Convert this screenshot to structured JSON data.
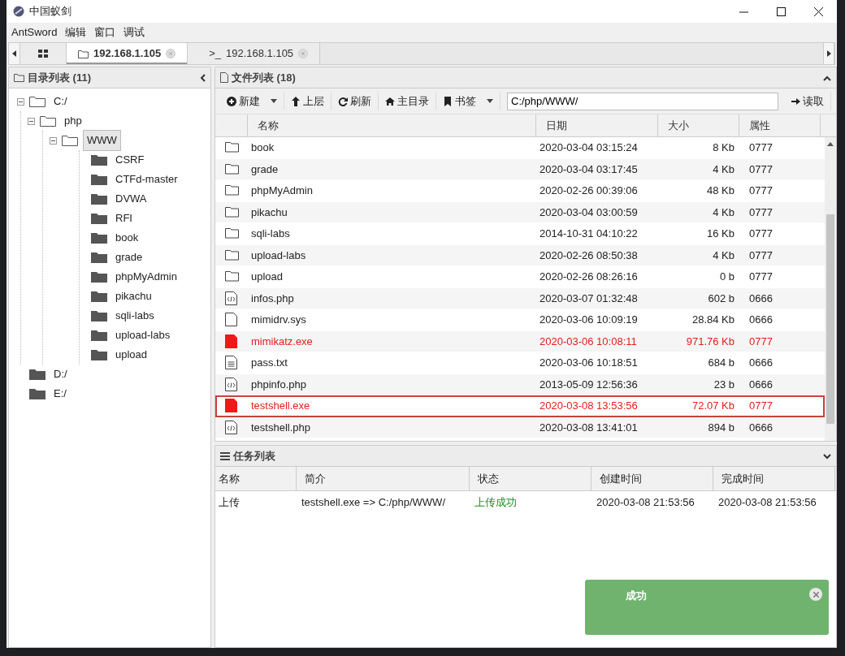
{
  "window": {
    "title": "中国蚁剑"
  },
  "menu": [
    "AntSword",
    "编辑",
    "窗口",
    "调试"
  ],
  "tabs": [
    {
      "kind": "home",
      "selected": false
    },
    {
      "kind": "files",
      "label": "192.168.1.105",
      "selected": true
    },
    {
      "kind": "terminal",
      "prefix": ">_",
      "label": "192.168.1.105",
      "selected": false
    }
  ],
  "dir_panel": {
    "title": "目录列表 (11)",
    "tree": [
      {
        "label": "C:/",
        "expanded": true,
        "selected": false,
        "children": [
          {
            "label": "php",
            "expanded": true,
            "selected": false,
            "children": [
              {
                "label": "WWW",
                "expanded": true,
                "selected": true,
                "children": [
                  {
                    "label": "CSRF",
                    "selected": false
                  },
                  {
                    "label": "CTFd-master",
                    "selected": false
                  },
                  {
                    "label": "DVWA",
                    "selected": false
                  },
                  {
                    "label": "RFI",
                    "selected": false
                  },
                  {
                    "label": "book",
                    "selected": false
                  },
                  {
                    "label": "grade",
                    "selected": false
                  },
                  {
                    "label": "phpMyAdmin",
                    "selected": false
                  },
                  {
                    "label": "pikachu",
                    "selected": false
                  },
                  {
                    "label": "sqli-labs",
                    "selected": false
                  },
                  {
                    "label": "upload-labs",
                    "selected": false
                  },
                  {
                    "label": "upload",
                    "selected": false
                  }
                ]
              }
            ]
          }
        ]
      },
      {
        "label": "D:/",
        "selected": false
      },
      {
        "label": "E:/",
        "selected": false
      }
    ]
  },
  "file_panel": {
    "title": "文件列表 (18)",
    "toolbar": [
      {
        "kind": "plus",
        "label": "新建",
        "dropdown": true
      },
      {
        "kind": "up",
        "label": "上层",
        "dropdown": false
      },
      {
        "kind": "refresh",
        "label": "刷新",
        "dropdown": false
      },
      {
        "kind": "home",
        "label": "主目录",
        "dropdown": false
      },
      {
        "kind": "bookmark",
        "label": "书签",
        "dropdown": true
      }
    ],
    "path": "C:/php/WWW/",
    "read_button": "读取",
    "columns": [
      "名称",
      "日期",
      "大小",
      "属性"
    ],
    "rows": [
      {
        "kind": "folder",
        "name": "book",
        "date": "2020-03-04 03:15:24",
        "size": "8 Kb",
        "attr": "0777",
        "highlighted": false
      },
      {
        "kind": "folder",
        "name": "grade",
        "date": "2020-03-04 03:17:45",
        "size": "4 Kb",
        "attr": "0777",
        "highlighted": false
      },
      {
        "kind": "folder",
        "name": "phpMyAdmin",
        "date": "2020-02-26 00:39:06",
        "size": "48 Kb",
        "attr": "0777",
        "highlighted": false
      },
      {
        "kind": "folder",
        "name": "pikachu",
        "date": "2020-03-04 03:00:59",
        "size": "4 Kb",
        "attr": "0777",
        "highlighted": false
      },
      {
        "kind": "folder",
        "name": "sqli-labs",
        "date": "2014-10-31 04:10:22",
        "size": "16 Kb",
        "attr": "0777",
        "highlighted": false
      },
      {
        "kind": "folder",
        "name": "upload-labs",
        "date": "2020-02-26 08:50:38",
        "size": "4 Kb",
        "attr": "0777",
        "highlighted": false
      },
      {
        "kind": "folder",
        "name": "upload",
        "date": "2020-02-26 08:26:16",
        "size": "0 b",
        "attr": "0777",
        "highlighted": false
      },
      {
        "kind": "code",
        "name": "infos.php",
        "date": "2020-03-07 01:32:48",
        "size": "602 b",
        "attr": "0666",
        "highlighted": false
      },
      {
        "kind": "file",
        "name": "mimidrv.sys",
        "date": "2020-03-06 10:09:19",
        "size": "28.84 Kb",
        "attr": "0666",
        "highlighted": false
      },
      {
        "kind": "exe",
        "name": "mimikatz.exe",
        "date": "2020-03-06 10:08:11",
        "size": "971.76 Kb",
        "attr": "0777",
        "highlighted": false
      },
      {
        "kind": "text",
        "name": "pass.txt",
        "date": "2020-03-06 10:18:51",
        "size": "684 b",
        "attr": "0666",
        "highlighted": false
      },
      {
        "kind": "code",
        "name": "phpinfo.php",
        "date": "2013-05-09 12:56:36",
        "size": "23 b",
        "attr": "0666",
        "highlighted": false
      },
      {
        "kind": "exe",
        "name": "testshell.exe",
        "date": "2020-03-08 13:53:56",
        "size": "72.07 Kb",
        "attr": "0777",
        "highlighted": true
      },
      {
        "kind": "code",
        "name": "testshell.php",
        "date": "2020-03-08 13:41:01",
        "size": "894 b",
        "attr": "0666",
        "highlighted": false
      }
    ]
  },
  "task_panel": {
    "title": "任务列表",
    "columns": [
      "名称",
      "简介",
      "状态",
      "创建时间",
      "完成时间"
    ],
    "rows": [
      {
        "name": "上传",
        "desc": "testshell.exe => C:/php/WWW/",
        "status": "上传成功",
        "created": "2020-03-08 21:53:56",
        "finished": "2020-03-08 21:53:56"
      }
    ]
  },
  "toast": {
    "kind": "success",
    "title": "成功"
  }
}
